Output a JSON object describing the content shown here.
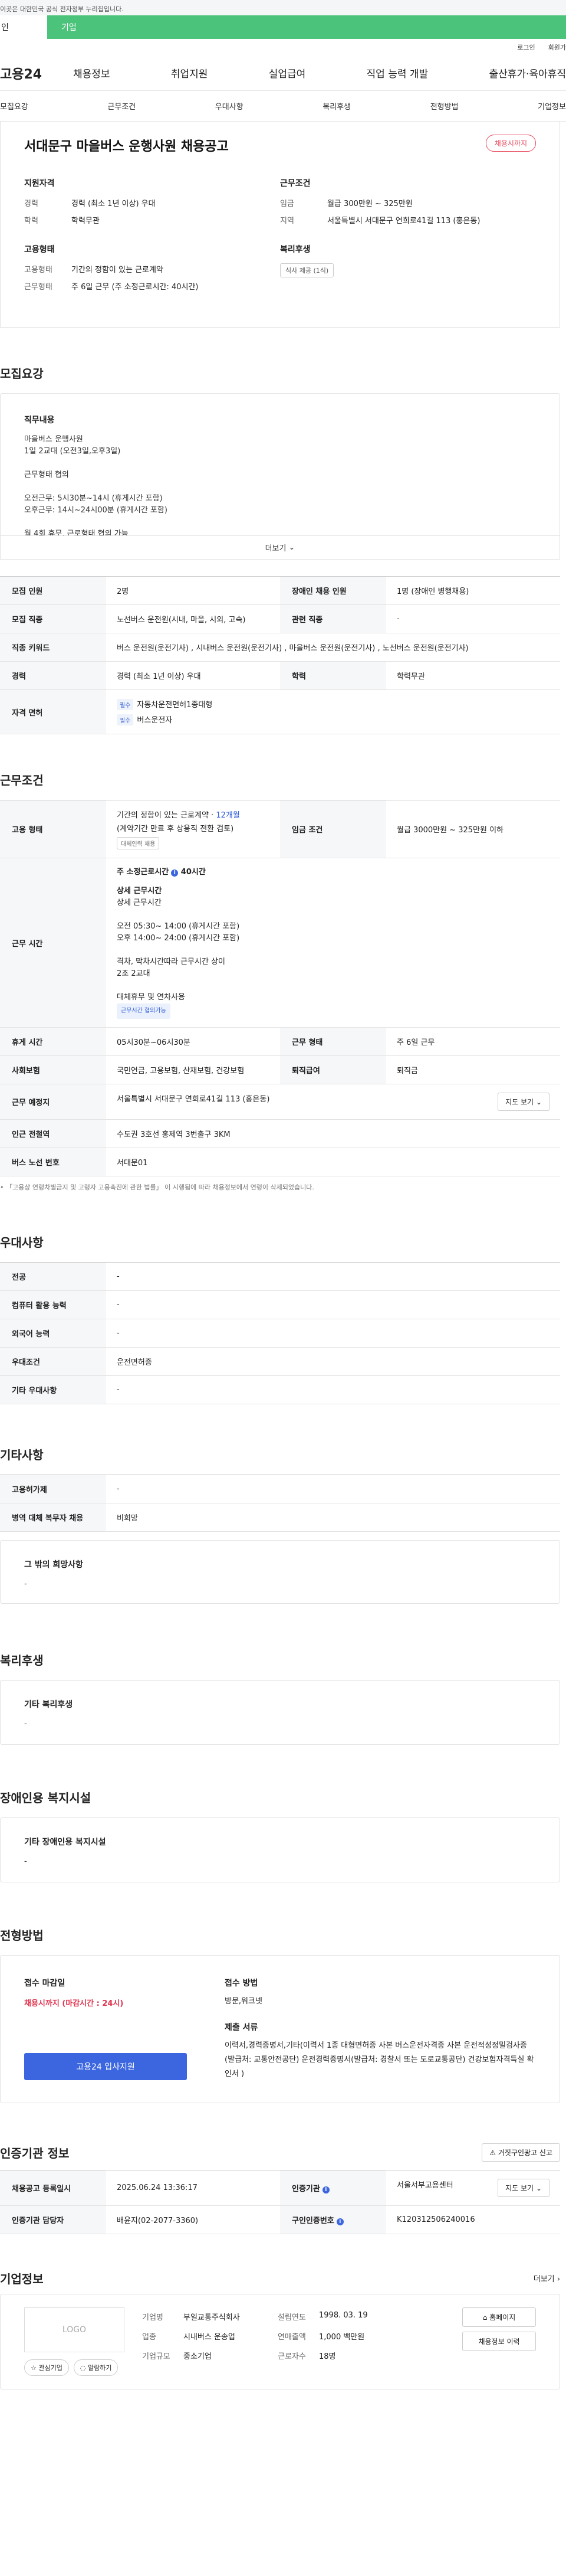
{
  "topbar": {
    "notice": "이곳은 대한민국 공식 전자정부 누리집입니다."
  },
  "tabs": {
    "person": "인",
    "company": "기업"
  },
  "util": {
    "login": "로그인",
    "join": "회원가"
  },
  "gnb": {
    "logo": "고용24",
    "items": [
      "채용정보",
      "취업지원",
      "실업급여",
      "직업 능력 개발",
      "출산휴가·육아휴직"
    ]
  },
  "subnav": [
    "모집요강",
    "근무조건",
    "우대사항",
    "복리후생",
    "전형방법",
    "기업정보"
  ],
  "summary": {
    "title": "서대문구 마을버스 운행사원 채용공고",
    "badge": "채용시까지",
    "qual": {
      "heading": "지원자격",
      "career_k": "경력",
      "career_v": "경력 (최소 1년 이상) 우대",
      "edu_k": "학력",
      "edu_v": "학력무관"
    },
    "emp": {
      "heading": "고용형태",
      "type_k": "고용형태",
      "type_v": "기간의 정함이 있는 근로계약",
      "days_k": "근무형태",
      "days_v": "주 6일 근무 (주 소정근로시간: 40시간)"
    },
    "cond": {
      "heading": "근무조건",
      "wage_k": "임금",
      "wage_v": "월급 300만원 ~ 325만원",
      "loc_k": "지역",
      "loc_v": "서울특별시 서대문구 연희로41길 113 (홍은동)"
    },
    "welfare": {
      "heading": "복리후생",
      "chip": "식사 제공 (1식)"
    }
  },
  "recruit": {
    "section": "모집요강",
    "duty_heading": "직무내용",
    "duty_lines": [
      "마을버스 운행사원",
      "1일 2교대 (오전3일,오후3일)",
      "",
      "근무형태 협의",
      "",
      "오전근무: 5시30분~14시 (휴게시간 포함)",
      "오후근무: 14시~24시00분 (휴게시간 포함)",
      "",
      "월 4회 휴무, 근로형태 협의 가능"
    ],
    "more": "더보기",
    "table": {
      "headcount_k": "모집 인원",
      "headcount_v": "2명",
      "disabled_k": "장애인 채용 인원",
      "disabled_v": "1명 (장애인 병행채용)",
      "job_k": "모집 직종",
      "job_v": "노선버스 운전원(시내, 마을, 시외, 고속)",
      "related_k": "관련 직종",
      "related_v": "-",
      "keyword_k": "직종 키워드",
      "keyword_v": "버스 운전원(운전기사) , 시내버스 운전원(운전기사) , 마을버스 운전원(운전기사) , 노선버스 운전원(운전기사)",
      "career_k": "경력",
      "career_v": "경력 (최소 1년 이상) 우대",
      "edu_k": "학력",
      "edu_v": "학력무관",
      "license_k": "자격 면허",
      "license_tag": "필수",
      "license_1": "자동차운전면허1종대형",
      "license_2": "버스운전자"
    }
  },
  "work": {
    "section": "근무조건",
    "type_k": "고용 형태",
    "type_line1": "기간의 정함이 있는 근로계약 · ",
    "type_months": "12개월",
    "type_line2": "(계약기간 만료 후 상용직 전환 검토)",
    "type_tag": "대체인력 채용",
    "wage_k": "임금 조건",
    "wage_v": "월급 3000만원 ~ 325만원 이하",
    "time_k": "근무 시간",
    "time_head": "주 소정근로시간",
    "time_hours": "40시간",
    "time_lines": [
      "상세 근무시간",
      "상세 근무시간",
      "",
      "오전 05:30~ 14:00 (휴게시간 포함)",
      "오후 14:00~ 24:00 (휴게시간 포함)",
      "",
      "격차, 막차시간따라 근무시간 상이",
      "2조 2교대",
      "",
      "대체휴무 및 연차사용"
    ],
    "time_tag": "근무시간 협의가능",
    "rest_k": "휴게 시간",
    "rest_v": "05시30분~06시30분",
    "form_k": "근무 형태",
    "form_v": "주 6일 근무",
    "ins_k": "사회보험",
    "ins_v": "국민연금, 고용보험, 산재보험, 건강보험",
    "retire_k": "퇴직급여",
    "retire_v": "퇴직금",
    "place_k": "근무 예정지",
    "place_v": "서울특별시 서대문구 연희로41길 113 (홍은동)",
    "map_btn": "지도 보기",
    "subway_k": "인근 전철역",
    "subway_v": "수도권 3호선 홍제역 3번출구 3KM",
    "bus_k": "버스 노선 번호",
    "bus_v": "서대문01",
    "note": "「고용상 연령차별금지 및 고령자 고용촉진에 관한 법률」 이 시행됨에 따라 채용정보에서 연령이 삭제되었습니다."
  },
  "prefer": {
    "section": "우대사항",
    "rows": [
      {
        "k": "전공",
        "v": "-"
      },
      {
        "k": "컴퓨터 활용 능력",
        "v": "-"
      },
      {
        "k": "외국어 능력",
        "v": "-"
      },
      {
        "k": "우대조건",
        "v": "운전면허증"
      },
      {
        "k": "기타 우대사항",
        "v": "-"
      }
    ]
  },
  "etc": {
    "section": "기타사항",
    "rows": [
      {
        "k": "고용허가제",
        "v": "-"
      },
      {
        "k": "병역 대체 복무자 채용",
        "v": "비희망"
      }
    ],
    "hope_heading": "그 밖의 희망사항",
    "hope_v": "-"
  },
  "welfare": {
    "section": "복리후생",
    "heading": "기타 복리후생",
    "v": "-"
  },
  "disabled": {
    "section": "장애인용 복지시설",
    "heading": "기타 장애인용 복지시설",
    "v": "-"
  },
  "apply": {
    "section": "전형방법",
    "deadline_heading": "접수 마감일",
    "deadline_v": "채용시까지 (마감시간 : 24시)",
    "method_heading": "접수 방법",
    "method_v": "방문,워크넷",
    "docs_heading": "제출 서류",
    "docs_v": "이력서,경력증명서,기타(이력서 1종 대형면허증 사본 버스운전자격증 사본 운전적성정밀검사증(발급처: 교통안전공단) 운전경력증명서(발급처: 경찰서 또는 도로교통공단) 건강보험자격득실 확인서 )",
    "apply_btn": "고용24 입사지원"
  },
  "agency": {
    "section": "인증기관 정보",
    "report_btn": "거짓구인광고 신고",
    "reg_k": "채용공고 등록일시",
    "reg_v": "2025.06.24 13:36:17",
    "org_k": "인증기관",
    "org_v": "서울서부고용센터",
    "map_btn": "지도 보기",
    "mgr_k": "인증기관 담당자",
    "mgr_v": "배윤지(02-2077-3360)",
    "num_k": "구인인증번호",
    "num_v": "K120312506240016"
  },
  "company": {
    "section": "기업정보",
    "more": "더보기",
    "logo": "LOGO",
    "fav_btn": "관심기업",
    "alarm_btn": "알람하기",
    "name_k": "기업명",
    "name_v": "부일교통주식회사",
    "since_k": "설립연도",
    "since_v": "1998. 03. 19",
    "ind_k": "업종",
    "ind_v": "시내버스 운송업",
    "sales_k": "연매출액",
    "sales_v": "1,000 백만원",
    "size_k": "기업규모",
    "size_v": "중소기업",
    "emp_k": "근로자수",
    "emp_v": "18명",
    "home_btn": "홈페이지",
    "jobs_btn": "채용정보 이력"
  },
  "colors": {
    "brand_green": "#4cc37b",
    "primary_blue": "#3b66e0",
    "alert_red": "#e0344f"
  }
}
